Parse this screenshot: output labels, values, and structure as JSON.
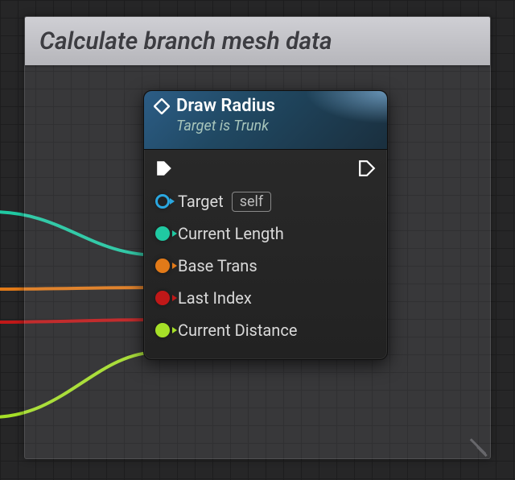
{
  "comment": {
    "title": "Calculate branch mesh data"
  },
  "node": {
    "title": "Draw Radius",
    "subtitle": "Target is Trunk",
    "pins": {
      "target": {
        "label": "Target",
        "default": "self",
        "color": "#2aa7e0"
      },
      "current_length": {
        "label": "Current Length",
        "color": "#20c9a2"
      },
      "base_trans": {
        "label": "Base Trans",
        "color": "#e27a18"
      },
      "last_index": {
        "label": "Last Index",
        "color": "#c01818"
      },
      "current_distance": {
        "label": "Current Distance",
        "color": "#a6e028"
      }
    }
  }
}
